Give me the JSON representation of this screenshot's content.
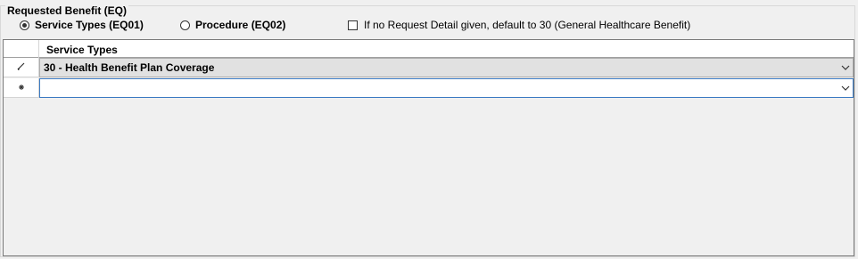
{
  "group": {
    "title": "Requested Benefit (EQ)"
  },
  "options": {
    "service_types": {
      "label": "Service Types (EQ01)",
      "selected": true
    },
    "procedure": {
      "label": "Procedure (EQ02)",
      "selected": false
    }
  },
  "default_checkbox": {
    "label": "If no Request Detail given, default to 30 (General Healthcare Benefit)",
    "checked": false
  },
  "grid": {
    "column_header": "Service Types",
    "rows": [
      {
        "indicator": "pencil-icon",
        "value": "30 - Health Benefit Plan Coverage"
      },
      {
        "indicator": "new-row-icon",
        "value": ""
      }
    ]
  }
}
